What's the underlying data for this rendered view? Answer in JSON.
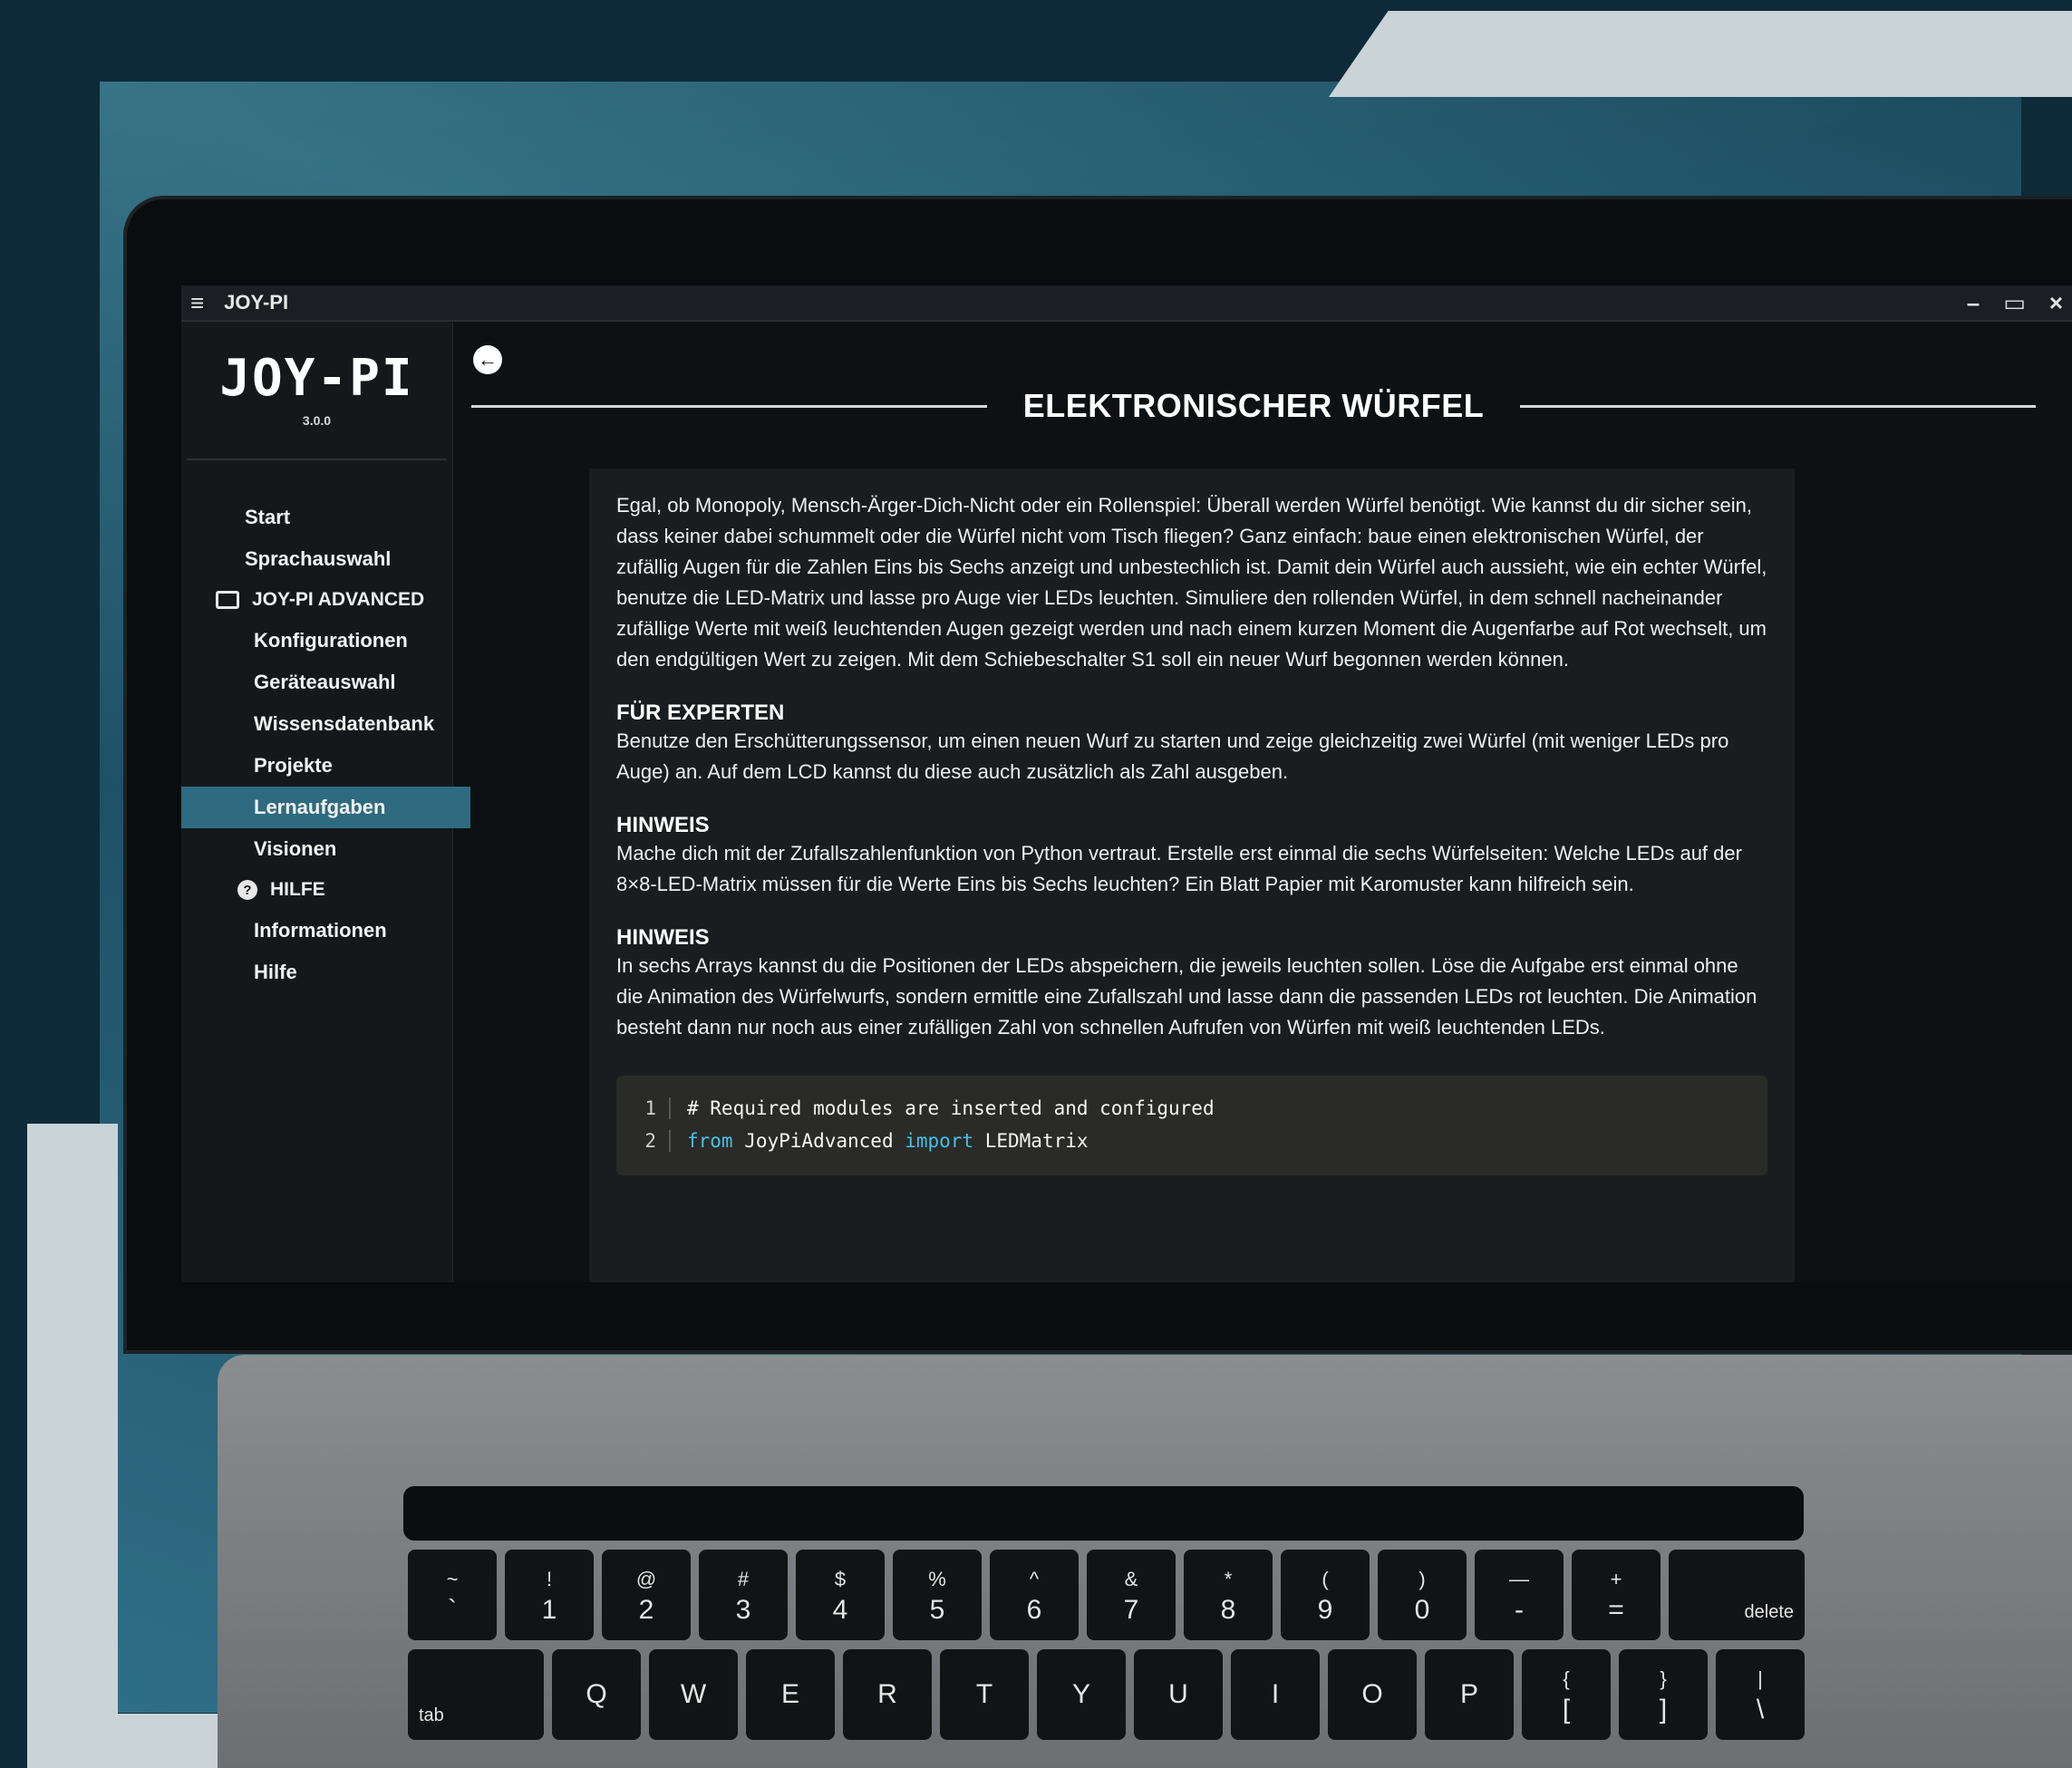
{
  "window": {
    "title": "JOY-PI",
    "controls": {
      "minimize": "–",
      "restore": "▭",
      "close": "×"
    }
  },
  "sidebar": {
    "logo": "JOY-PI",
    "version": "3.0.0",
    "items": [
      {
        "label": "Start"
      },
      {
        "label": "Sprachauswahl"
      }
    ],
    "group_advanced": {
      "label": "JOY-PI ADVANCED",
      "icon": "device-icon",
      "items": [
        {
          "label": "Konfigurationen"
        },
        {
          "label": "Geräteauswahl"
        },
        {
          "label": "Wissensdatenbank"
        },
        {
          "label": "Projekte"
        },
        {
          "label": "Lernaufgaben",
          "active": true
        },
        {
          "label": "Visionen"
        }
      ]
    },
    "group_help": {
      "label": "HILFE",
      "icon": "help-icon",
      "items": [
        {
          "label": "Informationen"
        },
        {
          "label": "Hilfe"
        }
      ]
    }
  },
  "main": {
    "back_icon": "←",
    "title": "ELEKTRONISCHER WÜRFEL",
    "intro": "Egal, ob Monopoly, Mensch-Ärger-Dich-Nicht oder ein Rollenspiel: Überall werden Würfel benötigt. Wie kannst du dir sicher sein, dass keiner dabei schummelt oder die Würfel nicht vom Tisch fliegen? Ganz einfach: baue einen elektronischen Würfel, der zufällig Augen für die Zahlen Eins bis Sechs anzeigt und unbestechlich ist. Damit dein Würfel auch aussieht, wie ein echter Würfel, benutze die LED-Matrix und lasse pro Auge vier LEDs leuchten. Simuliere den rollenden Würfel, in dem schnell nacheinander zufällige Werte mit weiß leuchtenden Augen gezeigt werden und nach einem kurzen Moment die Augenfarbe auf Rot wechselt, um den endgültigen Wert zu zeigen. Mit dem Schiebeschalter S1 soll ein neuer Wurf begonnen werden können.",
    "sections": [
      {
        "heading": "FÜR EXPERTEN",
        "text": "Benutze den Erschütterungssensor, um einen neuen Wurf zu starten und zeige gleichzeitig zwei Würfel (mit weniger LEDs pro Auge) an. Auf dem LCD kannst du diese auch zusätzlich als Zahl ausgeben."
      },
      {
        "heading": "HINWEIS",
        "text": "Mache dich mit der Zufallszahlenfunktion von Python vertraut. Erstelle erst einmal die sechs Würfelseiten: Welche LEDs auf der 8×8-LED-Matrix müssen für die Werte Eins bis Sechs leuchten? Ein Blatt Papier mit Karomuster kann hilfreich sein."
      },
      {
        "heading": "HINWEIS",
        "text": "In sechs Arrays kannst du die Positionen der LEDs abspeichern, die jeweils leuchten sollen. Löse die Aufgabe erst einmal ohne die Animation des Würfelwurfs, sondern ermittle eine Zufallszahl und lasse dann die passenden LEDs rot leuchten. Die Animation besteht dann nur noch aus einer zufälligen Zahl von schnellen Aufrufen von Würfen mit weiß leuchtenden LEDs."
      }
    ],
    "code": {
      "line1_num": "1",
      "line1_comment": "# Required modules are inserted and configured",
      "line2_num": "2",
      "line2_kw_from": "from",
      "line2_module": " JoyPiAdvanced ",
      "line2_kw_import": "import",
      "line2_name": " LEDMatrix"
    }
  },
  "keyboard": {
    "row1": [
      {
        "top": "~",
        "bottom": "`"
      },
      {
        "top": "!",
        "bottom": "1"
      },
      {
        "top": "@",
        "bottom": "2"
      },
      {
        "top": "#",
        "bottom": "3"
      },
      {
        "top": "$",
        "bottom": "4"
      },
      {
        "top": "%",
        "bottom": "5"
      },
      {
        "top": "^",
        "bottom": "6"
      },
      {
        "top": "&",
        "bottom": "7"
      },
      {
        "top": "*",
        "bottom": "8"
      },
      {
        "top": "(",
        "bottom": "9"
      },
      {
        "top": ")",
        "bottom": "0"
      },
      {
        "top": "—",
        "bottom": "-"
      },
      {
        "top": "+",
        "bottom": "="
      }
    ],
    "delete_label": "delete",
    "tab_label": "tab",
    "row2": [
      {
        "top": "",
        "bottom": "Q"
      },
      {
        "top": "",
        "bottom": "W"
      },
      {
        "top": "",
        "bottom": "E"
      },
      {
        "top": "",
        "bottom": "R"
      },
      {
        "top": "",
        "bottom": "T"
      },
      {
        "top": "",
        "bottom": "Y"
      },
      {
        "top": "",
        "bottom": "U"
      },
      {
        "top": "",
        "bottom": "I"
      },
      {
        "top": "",
        "bottom": "O"
      },
      {
        "top": "",
        "bottom": "P"
      },
      {
        "top": "{",
        "bottom": "["
      },
      {
        "top": "}",
        "bottom": "]"
      },
      {
        "top": "|",
        "bottom": "\\"
      }
    ]
  },
  "colors": {
    "accent": "#2e6b80",
    "background": "#0f2a38",
    "code_keyword": "#45c0e8"
  }
}
